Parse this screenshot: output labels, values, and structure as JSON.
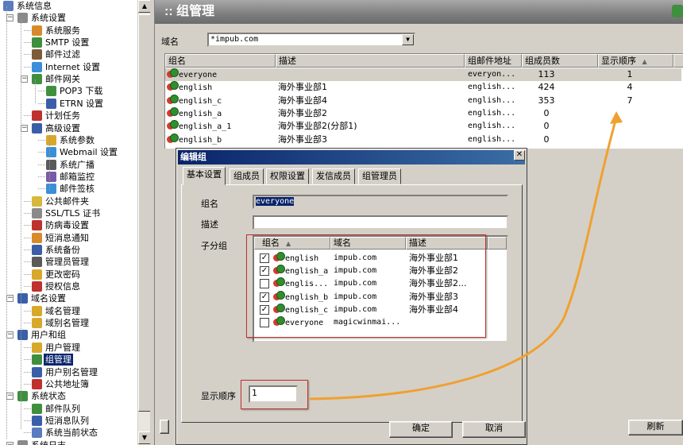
{
  "tree": {
    "items": [
      {
        "label": "系统信息",
        "level": 0,
        "expander": "",
        "icon_color": "#5a7bbf",
        "icon": "info-icon"
      },
      {
        "label": "系统设置",
        "level": 1,
        "expander": "−",
        "icon_color": "#8a8a8a",
        "icon": "gears-icon"
      },
      {
        "label": "系统服务",
        "level": 2,
        "expander": "",
        "icon_color": "#d88a2a",
        "icon": "service-icon"
      },
      {
        "label": "SMTP 设置",
        "level": 2,
        "expander": "",
        "icon_color": "#3f8f3f",
        "icon": "smtp-icon"
      },
      {
        "label": "邮件过滤",
        "level": 2,
        "expander": "",
        "icon_color": "#7d5a3a",
        "icon": "filter-icon"
      },
      {
        "label": "Internet 设置",
        "level": 2,
        "expander": "",
        "icon_color": "#3a8fd8",
        "icon": "internet-icon"
      },
      {
        "label": "邮件网关",
        "level": 2,
        "expander": "−",
        "icon_color": "#3f8f3f",
        "icon": "gateway-icon"
      },
      {
        "label": "POP3 下载",
        "level": 3,
        "expander": "",
        "icon_color": "#3f8f3f",
        "icon": "pop3-icon"
      },
      {
        "label": "ETRN 设置",
        "level": 3,
        "expander": "",
        "icon_color": "#3a5fa8",
        "icon": "etrn-icon"
      },
      {
        "label": "计划任务",
        "level": 2,
        "expander": "",
        "icon_color": "#c0302c",
        "icon": "schedule-icon"
      },
      {
        "label": "高级设置",
        "level": 2,
        "expander": "−",
        "icon_color": "#3a5fa8",
        "icon": "advanced-icon"
      },
      {
        "label": "系统参数",
        "level": 3,
        "expander": "",
        "icon_color": "#d8a82a",
        "icon": "params-icon"
      },
      {
        "label": "Webmail 设置",
        "level": 3,
        "expander": "",
        "icon_color": "#3a8fd8",
        "icon": "webmail-icon"
      },
      {
        "label": "系统广播",
        "level": 3,
        "expander": "",
        "icon_color": "#5a5a5a",
        "icon": "broadcast-icon"
      },
      {
        "label": "邮箱监控",
        "level": 3,
        "expander": "",
        "icon_color": "#7a5aa8",
        "icon": "monitor-icon"
      },
      {
        "label": "邮件签核",
        "level": 3,
        "expander": "",
        "icon_color": "#3a8fd8",
        "icon": "signoff-icon"
      },
      {
        "label": "公共邮件夹",
        "level": 2,
        "expander": "",
        "icon_color": "#d8b83a",
        "icon": "folder-icon"
      },
      {
        "label": "SSL/TLS 证书",
        "level": 2,
        "expander": "",
        "icon_color": "#8a8a8a",
        "icon": "certificate-icon"
      },
      {
        "label": "防病毒设置",
        "level": 2,
        "expander": "",
        "icon_color": "#c0302c",
        "icon": "antivirus-icon"
      },
      {
        "label": "短消息通知",
        "level": 2,
        "expander": "",
        "icon_color": "#d88a2a",
        "icon": "sms-icon"
      },
      {
        "label": "系统备份",
        "level": 2,
        "expander": "",
        "icon_color": "#3a5fa8",
        "icon": "backup-icon"
      },
      {
        "label": "管理员管理",
        "level": 2,
        "expander": "",
        "icon_color": "#5a5a5a",
        "icon": "admin-icon"
      },
      {
        "label": "更改密码",
        "level": 2,
        "expander": "",
        "icon_color": "#d8a82a",
        "icon": "key-icon"
      },
      {
        "label": "授权信息",
        "level": 2,
        "expander": "",
        "icon_color": "#c0302c",
        "icon": "license-icon"
      },
      {
        "label": "域名设置",
        "level": 1,
        "expander": "−",
        "icon_color": "#3a5fa8",
        "icon": "domain-settings-icon"
      },
      {
        "label": "域名管理",
        "level": 2,
        "expander": "",
        "icon_color": "#d8a82a",
        "icon": "domain-icon"
      },
      {
        "label": "域别名管理",
        "level": 2,
        "expander": "",
        "icon_color": "#d8a82a",
        "icon": "domain-alias-icon"
      },
      {
        "label": "用户和组",
        "level": 1,
        "expander": "−",
        "icon_color": "#3a5fa8",
        "icon": "users-groups-icon"
      },
      {
        "label": "用户管理",
        "level": 2,
        "expander": "",
        "icon_color": "#d8a82a",
        "icon": "user-icon"
      },
      {
        "label": "组管理",
        "level": 2,
        "expander": "",
        "icon_color": "#3f8f3f",
        "icon": "group-icon",
        "selected": true
      },
      {
        "label": "用户别名管理",
        "level": 2,
        "expander": "",
        "icon_color": "#3a5fa8",
        "icon": "user-alias-icon"
      },
      {
        "label": "公共地址簿",
        "level": 2,
        "expander": "",
        "icon_color": "#c0302c",
        "icon": "addressbook-icon"
      },
      {
        "label": "系统状态",
        "level": 1,
        "expander": "−",
        "icon_color": "#3f8f3f",
        "icon": "status-icon"
      },
      {
        "label": "邮件队列",
        "level": 2,
        "expander": "",
        "icon_color": "#3f8f3f",
        "icon": "queue-icon"
      },
      {
        "label": "短消息队列",
        "level": 2,
        "expander": "",
        "icon_color": "#3a5fa8",
        "icon": "sms-queue-icon"
      },
      {
        "label": "系统当前状态",
        "level": 2,
        "expander": "",
        "icon_color": "#5a7bbf",
        "icon": "current-status-icon"
      },
      {
        "label": "系统日志",
        "level": 1,
        "expander": "−",
        "icon_color": "#8a8a8a",
        "icon": "log-icon"
      }
    ]
  },
  "header": {
    "title": ":: 组管理"
  },
  "domain": {
    "label": "域名",
    "value": "*impub.com"
  },
  "grid": {
    "columns": [
      "组名",
      "描述",
      "组邮件地址",
      "组成员数",
      "显示顺序"
    ],
    "sort_indicator": "▲",
    "rows": [
      {
        "name": "everyone",
        "desc": "",
        "email": "everyon...",
        "members": "113",
        "order": "1"
      },
      {
        "name": "english",
        "desc": "海外事业部1",
        "email": "english...",
        "members": "424",
        "order": "4"
      },
      {
        "name": "english_c",
        "desc": "海外事业部4",
        "email": "english...",
        "members": "353",
        "order": "7"
      },
      {
        "name": "english_a",
        "desc": "海外事业部2",
        "email": "english...",
        "members": "0",
        "order": ""
      },
      {
        "name": "english_a_1",
        "desc": "海外事业部2(分部1)",
        "email": "english...",
        "members": "0",
        "order": ""
      },
      {
        "name": "english_b",
        "desc": "海外事业部3",
        "email": "english...",
        "members": "0",
        "order": ""
      }
    ]
  },
  "footer": {
    "refresh": "刷新"
  },
  "dialog": {
    "title": "编辑组",
    "close": "✕",
    "tabs": [
      "基本设置",
      "组成员",
      "权限设置",
      "发信成员",
      "组管理员"
    ],
    "name_label": "组名",
    "name_value": "everyone",
    "desc_label": "描述",
    "desc_value": "",
    "subgroup_label": "子分组",
    "sub_columns": [
      "组名",
      "域名",
      "描述"
    ],
    "sub_sort": "▲",
    "subgroups": [
      {
        "checked": "✓",
        "name": "english",
        "domain": "impub.com",
        "desc": "海外事业部1"
      },
      {
        "checked": "✓",
        "name": "english_a",
        "domain": "impub.com",
        "desc": "海外事业部2"
      },
      {
        "checked": "",
        "name": "englis...",
        "domain": "impub.com",
        "desc": "海外事业部2..."
      },
      {
        "checked": "✓",
        "name": "english_b",
        "domain": "impub.com",
        "desc": "海外事业部3"
      },
      {
        "checked": "✓",
        "name": "english_c",
        "domain": "impub.com",
        "desc": "海外事业部4"
      },
      {
        "checked": "",
        "name": "everyone",
        "domain": "magicwinmai...",
        "desc": ""
      }
    ],
    "order_label": "显示顺序",
    "order_value": "1",
    "ok": "确定",
    "cancel": "取消"
  },
  "annotation": {
    "box_color": "#c0302c",
    "arrow_color": "#f0a030"
  }
}
